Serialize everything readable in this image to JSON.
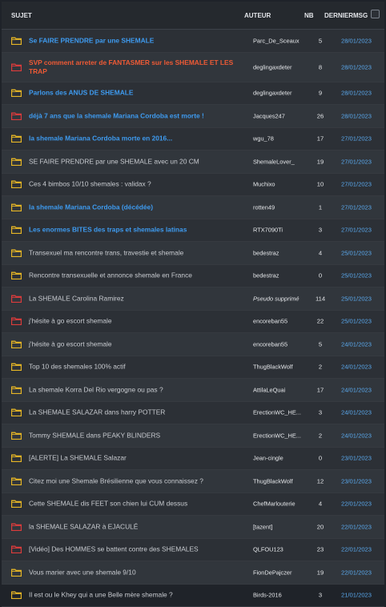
{
  "header": {
    "subject": "SUJET",
    "author": "AUTEUR",
    "count": "NB",
    "last_line1": "DERNIER",
    "last_line2": "MSG"
  },
  "colors": {
    "folder_yellow": "#e6b626",
    "folder_red": "#dc3c3c",
    "link_blue": "#3e9bf0",
    "hot_orange": "#ef5a35",
    "date_blue": "#5aa9ee"
  },
  "topics": [
    {
      "title": "Se FAIRE PRENDRE par une SHEMALE",
      "author": "Parc_De_Sceaux",
      "count": "5",
      "date": "28/01/2023",
      "style": "link",
      "icon": "folder-icon",
      "folder": "yellow"
    },
    {
      "title": "SVP comment arreter de FANTASMER sur les SHEMALE ET LES TRAP",
      "author": "deglingaxdeter",
      "count": "8",
      "date": "28/01/2023",
      "style": "hot",
      "icon": "folder-hot-icon",
      "folder": "red"
    },
    {
      "title": "Parlons des ANUS DE SHEMALE",
      "author": "deglingaxdeter",
      "count": "9",
      "date": "28/01/2023",
      "style": "link",
      "icon": "folder-icon",
      "folder": "yellow"
    },
    {
      "title": "déjà 7 ans que la shemale Mariana Cordoba est morte !",
      "author": "Jacques247",
      "count": "26",
      "date": "28/01/2023",
      "style": "link",
      "icon": "folder-hot-icon",
      "folder": "red"
    },
    {
      "title": "la shemale Mariana Cordoba morte en 2016...",
      "author": "wgu_78",
      "count": "17",
      "date": "27/01/2023",
      "style": "link",
      "icon": "folder-icon",
      "folder": "yellow"
    },
    {
      "title": "SE FAIRE PRENDRE par une SHEMALE avec un 20 CM",
      "author": "ShemaleLover_",
      "count": "19",
      "date": "27/01/2023",
      "style": "normal",
      "icon": "folder-icon",
      "folder": "yellow"
    },
    {
      "title": "Ces 4 bimbos 10/10 shemales : validax ?",
      "author": "Muchixo",
      "count": "10",
      "date": "27/01/2023",
      "style": "normal",
      "icon": "folder-icon",
      "folder": "yellow"
    },
    {
      "title": "la shemale Mariana Cordoba (décédée)",
      "author": "rotten49",
      "count": "1",
      "date": "27/01/2023",
      "style": "link",
      "icon": "folder-icon",
      "folder": "yellow"
    },
    {
      "title": "Les enormes BITES des traps et shemales latinas",
      "author": "RTX7090Ti",
      "count": "3",
      "date": "27/01/2023",
      "style": "link",
      "icon": "folder-icon",
      "folder": "yellow"
    },
    {
      "title": "Transexuel ma rencontre trans, travestie et shemale",
      "author": "bedestraz",
      "count": "4",
      "date": "25/01/2023",
      "style": "normal",
      "icon": "folder-icon",
      "folder": "yellow"
    },
    {
      "title": "Rencontre transexuelle et annonce shemale en France",
      "author": "bedestraz",
      "count": "0",
      "date": "25/01/2023",
      "style": "normal",
      "icon": "folder-icon",
      "folder": "yellow"
    },
    {
      "title": "La SHEMALE Carolina Ramirez",
      "author": "Pseudo supprimé",
      "count": "114",
      "date": "25/01/2023",
      "style": "normal",
      "icon": "folder-hot-icon",
      "folder": "red",
      "deleted": true
    },
    {
      "title": "j'hésite à go escort shemale",
      "author": "encoreban55",
      "count": "22",
      "date": "25/01/2023",
      "style": "normal",
      "icon": "folder-hot-icon",
      "folder": "red"
    },
    {
      "title": "j'hésite à go escort shemale",
      "author": "encoreban55",
      "count": "5",
      "date": "24/01/2023",
      "style": "normal",
      "icon": "folder-icon",
      "folder": "yellow"
    },
    {
      "title": "Top 10 des shemales 100% actif",
      "author": "ThugBlackWolf",
      "count": "2",
      "date": "24/01/2023",
      "style": "normal",
      "icon": "folder-icon",
      "folder": "yellow"
    },
    {
      "title": "La shemale Korra Del Rio vergogne ou pas ?",
      "author": "AttilaLeQuai",
      "count": "17",
      "date": "24/01/2023",
      "style": "normal",
      "icon": "folder-icon",
      "folder": "yellow"
    },
    {
      "title": "La SHEMALE SALAZAR dans harry POTTER",
      "author": "ErectionWC_HE...",
      "count": "3",
      "date": "24/01/2023",
      "style": "normal",
      "icon": "folder-icon",
      "folder": "yellow"
    },
    {
      "title": "Tommy SHEMALE dans PEAKY BLINDERS",
      "author": "ErectionWC_HE...",
      "count": "2",
      "date": "24/01/2023",
      "style": "normal",
      "icon": "folder-icon",
      "folder": "yellow"
    },
    {
      "title": "[ALERTE] La SHEMALE Salazar",
      "author": "Jean-cingle",
      "count": "0",
      "date": "23/01/2023",
      "style": "normal",
      "icon": "folder-icon",
      "folder": "yellow"
    },
    {
      "title": "Citez moi une Shemale Brésilienne que vous connaissez ?",
      "author": "ThugBlackWolf",
      "count": "12",
      "date": "23/01/2023",
      "style": "normal",
      "icon": "folder-icon",
      "folder": "yellow"
    },
    {
      "title": "Cette SHEMALE dis FEET son chien lui CUM dessus",
      "author": "ChefMarlouterie",
      "count": "4",
      "date": "22/01/2023",
      "style": "normal",
      "icon": "folder-icon",
      "folder": "yellow"
    },
    {
      "title": "la SHEMALE SALAZAR à EJACULÉ",
      "author": "[tazent]",
      "count": "20",
      "date": "22/01/2023",
      "style": "normal",
      "icon": "folder-hot-icon",
      "folder": "red"
    },
    {
      "title": "[Vidéo] Des HOMMES se battent contre des SHEMALES",
      "author": "QLFOU123",
      "count": "23",
      "date": "22/01/2023",
      "style": "normal",
      "icon": "folder-hot-icon",
      "folder": "red"
    },
    {
      "title": "Vous marier avec une shemale 9/10",
      "author": "FionDePajczer",
      "count": "19",
      "date": "22/01/2023",
      "style": "normal",
      "icon": "folder-icon",
      "folder": "yellow"
    },
    {
      "title": "Il est ou le Khey qui a une Belle mère shemale ?",
      "author": "Birds-2016",
      "count": "3",
      "date": "21/01/2023",
      "style": "normal",
      "icon": "folder-icon",
      "folder": "yellow"
    }
  ]
}
